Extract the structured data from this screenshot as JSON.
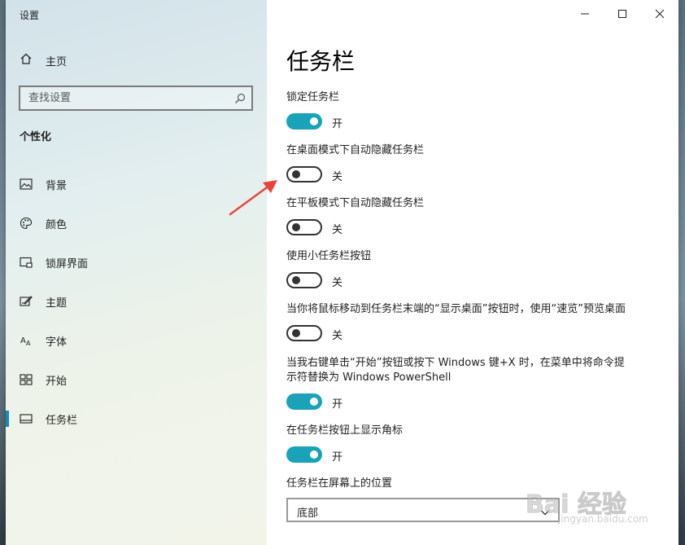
{
  "window": {
    "title": "设置"
  },
  "sidebar": {
    "home_label": "主页",
    "search_placeholder": "查找设置",
    "section_title": "个性化",
    "items": [
      {
        "label": "背景",
        "icon": "picture-icon"
      },
      {
        "label": "颜色",
        "icon": "palette-icon"
      },
      {
        "label": "锁屏界面",
        "icon": "lock-screen-icon"
      },
      {
        "label": "主题",
        "icon": "theme-icon"
      },
      {
        "label": "字体",
        "icon": "font-icon"
      },
      {
        "label": "开始",
        "icon": "start-icon"
      },
      {
        "label": "任务栏",
        "icon": "taskbar-icon",
        "active": true
      }
    ]
  },
  "main": {
    "title": "任务栏",
    "settings": [
      {
        "label": "锁定任务栏",
        "state": "开",
        "on": true
      },
      {
        "label": "在桌面模式下自动隐藏任务栏",
        "state": "关",
        "on": false
      },
      {
        "label": "在平板模式下自动隐藏任务栏",
        "state": "关",
        "on": false
      },
      {
        "label": "使用小任务栏按钮",
        "state": "关",
        "on": false
      },
      {
        "label": "当你将鼠标移动到任务栏末端的“显示桌面”按钮时，使用“速览”预览桌面",
        "state": "关",
        "on": false
      },
      {
        "label_line1": "当我右键单击“开始”按钮或按下 Windows 键+X 时，在菜单中将命令提",
        "label_line2": "示符替换为 Windows PowerShell",
        "state": "开",
        "on": true
      },
      {
        "label": "在任务栏按钮上显示角标",
        "state": "开",
        "on": true
      }
    ],
    "position_label": "任务栏在屏幕上的位置",
    "position_value": "底部"
  },
  "watermark": {
    "main": "Bai 经验",
    "url": "jingyan.baidu.com"
  },
  "colors": {
    "accent": "#1aa3b8",
    "nav_accent": "#0e8cbf",
    "annotation": "#e8463c"
  }
}
